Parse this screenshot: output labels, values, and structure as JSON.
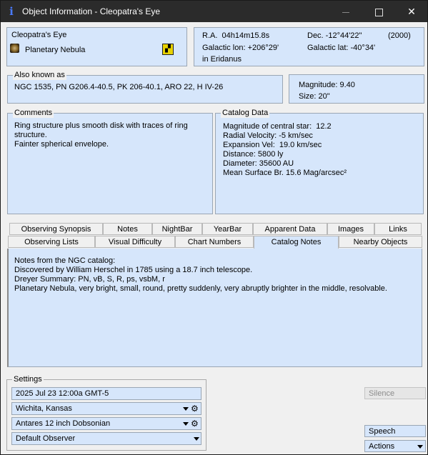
{
  "window": {
    "title": "Object Information - Cleopatra's Eye",
    "app_icon": "info-icon"
  },
  "object": {
    "name": "Cleopatra's Eye",
    "type": "Planetary Nebula"
  },
  "coords": {
    "ra": "R.A.  04h14m15.8s",
    "dec": "Dec. -12°44'22\"",
    "epoch": "(2000)",
    "gal_lon": "Galactic lon: +206°29'",
    "gal_lat": "Galactic lat: -40°34'",
    "constellation": "in Eridanus"
  },
  "aka": {
    "title": "Also known as",
    "value": "NGC 1535, PN G206.4-40.5, PK 206-40.1, ARO 22, H IV-26"
  },
  "mag": {
    "magnitude": "Magnitude: 9.40",
    "size": "Size: 20\""
  },
  "comments": {
    "title": "Comments",
    "line1": "Ring structure plus smooth disk with traces of ring",
    "line2": "structure.",
    "line3": "Fainter spherical envelope."
  },
  "catalog": {
    "title": "Catalog Data",
    "central_star": "Magnitude of central star:  12.2",
    "radial_velocity": "Radial Velocity: -5 km/sec",
    "expansion": "Expansion Vel:  19.0 km/sec",
    "distance": "Distance: 5800 ly",
    "diameter": "Diameter: 35600 AU",
    "surface_brightness": "Mean Surface Br. 15.6 Mag/arcsec²"
  },
  "tabs": {
    "row1": [
      "Observing Synopsis",
      "Notes",
      "NightBar",
      "YearBar",
      "Apparent Data",
      "Images",
      "Links"
    ],
    "row2": [
      "Observing Lists",
      "Visual Difficulty",
      "Chart Numbers",
      "Catalog Notes",
      "Nearby Objects"
    ],
    "active": "Catalog Notes"
  },
  "notes": {
    "line1": "Notes from the NGC catalog:",
    "line2": "Discovered by William Herschel in 1785 using a 18.7 inch telescope.",
    "line3": "Dreyer Summary: PN, vB, S, R, ps, vsbM, r",
    "line4": "Planetary Nebula, very bright, small, round, pretty suddenly, very abruptly brighter in the middle, resolvable."
  },
  "settings": {
    "title": "Settings",
    "datetime": "2025 Jul 23 12:00a GMT-5",
    "location": "Wichita, Kansas",
    "telescope": "Antares 12 inch Dobsonian",
    "observer": "Default Observer"
  },
  "buttons": {
    "silence": "Silence",
    "speech": "Speech",
    "actions": "Actions"
  }
}
